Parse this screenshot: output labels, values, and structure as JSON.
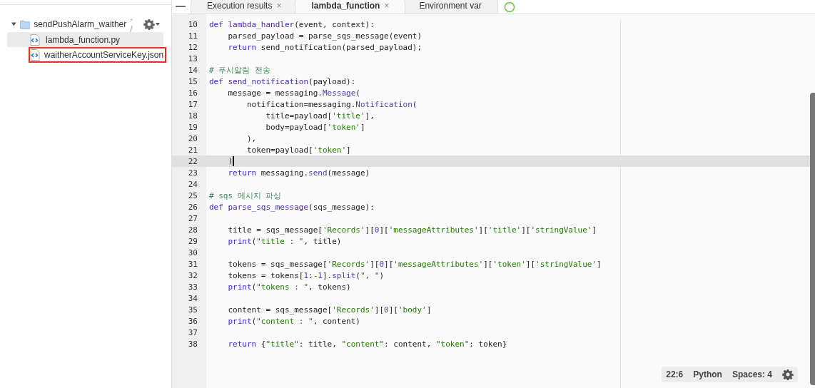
{
  "tabs": [
    {
      "label": "Execution results",
      "close": "×",
      "selected": false
    },
    {
      "label": "lambda_function",
      "close": "×",
      "selected": true
    },
    {
      "label": "Environment var",
      "selected": false
    }
  ],
  "file_tree": {
    "folder": {
      "name": "sendPushAlarm_waither",
      "path": " - /",
      "expanded": true,
      "children": [
        {
          "name": "lambda_function.py",
          "selected": true,
          "annotated": false
        },
        {
          "name": "waitherAccountServiceKey.json",
          "selected": false,
          "annotated": true
        }
      ]
    }
  },
  "editor": {
    "lines": [
      {
        "number": "10",
        "current": false,
        "tokens": [
          {
            "kind": "kw",
            "text": "def "
          },
          {
            "kind": "fn",
            "text": "lambda_handler"
          },
          {
            "kind": "plain",
            "text": "(event, context):"
          }
        ]
      },
      {
        "number": "11",
        "current": false,
        "tokens": [
          {
            "kind": "plain",
            "text": "    parsed_payload = parse_sqs_message(event)"
          }
        ]
      },
      {
        "number": "12",
        "current": false,
        "tokens": [
          {
            "kind": "kw",
            "text": "    return"
          },
          {
            "kind": "plain",
            "text": " send_notification(parsed_payload);"
          }
        ]
      },
      {
        "number": "13",
        "current": false
      },
      {
        "number": "14",
        "current": false,
        "tokens": [
          {
            "kind": "comment",
            "text": "# 푸시알림 전송"
          }
        ]
      },
      {
        "number": "15",
        "current": false,
        "tokens": [
          {
            "kind": "kw",
            "text": "def "
          },
          {
            "kind": "fn",
            "text": "send_notification"
          },
          {
            "kind": "plain",
            "text": "(payload):"
          }
        ]
      },
      {
        "number": "16",
        "current": false,
        "tokens": [
          {
            "kind": "plain",
            "text": "    message = messaging."
          },
          {
            "kind": "prop",
            "text": "Message"
          },
          {
            "kind": "plain",
            "text": "("
          }
        ]
      },
      {
        "number": "17",
        "current": false,
        "tokens": [
          {
            "kind": "plain",
            "text": "        notification=messaging."
          },
          {
            "kind": "prop",
            "text": "Notification"
          },
          {
            "kind": "plain",
            "text": "("
          }
        ]
      },
      {
        "number": "18",
        "current": false,
        "tokens": [
          {
            "kind": "plain",
            "text": "            title=payload["
          },
          {
            "kind": "str",
            "text": "'title'"
          },
          {
            "kind": "plain",
            "text": "],"
          }
        ]
      },
      {
        "number": "19",
        "current": false,
        "tokens": [
          {
            "kind": "plain",
            "text": "            body=payload["
          },
          {
            "kind": "str",
            "text": "'token'"
          },
          {
            "kind": "plain",
            "text": "]"
          }
        ]
      },
      {
        "number": "20",
        "current": false,
        "tokens": [
          {
            "kind": "plain",
            "text": "        ),"
          }
        ]
      },
      {
        "number": "21",
        "current": false,
        "tokens": [
          {
            "kind": "plain",
            "text": "        token=payload["
          },
          {
            "kind": "str",
            "text": "'token'"
          },
          {
            "kind": "plain",
            "text": "]"
          }
        ]
      },
      {
        "number": "22",
        "current": true,
        "tokens": [
          {
            "kind": "plain",
            "text": "    )"
          }
        ]
      },
      {
        "number": "23",
        "current": false,
        "tokens": [
          {
            "kind": "kw",
            "text": "    return"
          },
          {
            "kind": "plain",
            "text": " messaging."
          },
          {
            "kind": "prop",
            "text": "send"
          },
          {
            "kind": "plain",
            "text": "(message)"
          }
        ]
      },
      {
        "number": "24",
        "current": false
      },
      {
        "number": "25",
        "current": false,
        "tokens": [
          {
            "kind": "comment",
            "text": "# sqs 메시지 파싱"
          }
        ]
      },
      {
        "number": "26",
        "current": false,
        "tokens": [
          {
            "kind": "kw",
            "text": "def "
          },
          {
            "kind": "fn",
            "text": "parse_sqs_message"
          },
          {
            "kind": "plain",
            "text": "(sqs_message):"
          }
        ]
      },
      {
        "number": "27",
        "current": false
      },
      {
        "number": "28",
        "current": false,
        "tokens": [
          {
            "kind": "plain",
            "text": "    title = sqs_message["
          },
          {
            "kind": "str",
            "text": "'Records'"
          },
          {
            "kind": "plain",
            "text": "]["
          },
          {
            "kind": "num",
            "text": "0"
          },
          {
            "kind": "plain",
            "text": "]["
          },
          {
            "kind": "str",
            "text": "'messageAttributes'"
          },
          {
            "kind": "plain",
            "text": "]["
          },
          {
            "kind": "str",
            "text": "'title'"
          },
          {
            "kind": "plain",
            "text": "]["
          },
          {
            "kind": "str",
            "text": "'stringValue'"
          },
          {
            "kind": "plain",
            "text": "]"
          }
        ]
      },
      {
        "number": "29",
        "current": false,
        "tokens": [
          {
            "kind": "kw",
            "text": "    print"
          },
          {
            "kind": "plain",
            "text": "("
          },
          {
            "kind": "str",
            "text": "\"title : \""
          },
          {
            "kind": "plain",
            "text": ", title)"
          }
        ]
      },
      {
        "number": "30",
        "current": false
      },
      {
        "number": "31",
        "current": false,
        "tokens": [
          {
            "kind": "plain",
            "text": "    tokens = sqs_message["
          },
          {
            "kind": "str",
            "text": "'Records'"
          },
          {
            "kind": "plain",
            "text": "]["
          },
          {
            "kind": "num",
            "text": "0"
          },
          {
            "kind": "plain",
            "text": "]["
          },
          {
            "kind": "str",
            "text": "'messageAttributes'"
          },
          {
            "kind": "plain",
            "text": "]["
          },
          {
            "kind": "str",
            "text": "'token'"
          },
          {
            "kind": "plain",
            "text": "]["
          },
          {
            "kind": "str",
            "text": "'stringValue'"
          },
          {
            "kind": "plain",
            "text": "]"
          }
        ]
      },
      {
        "number": "32",
        "current": false,
        "tokens": [
          {
            "kind": "plain",
            "text": "    tokens = tokens["
          },
          {
            "kind": "num",
            "text": "1"
          },
          {
            "kind": "plain",
            "text": ":"
          },
          {
            "kind": "num",
            "text": "-1"
          },
          {
            "kind": "plain",
            "text": "]."
          },
          {
            "kind": "prop",
            "text": "split"
          },
          {
            "kind": "plain",
            "text": "("
          },
          {
            "kind": "str",
            "text": "\", \""
          },
          {
            "kind": "plain",
            "text": ")"
          }
        ]
      },
      {
        "number": "33",
        "current": false,
        "tokens": [
          {
            "kind": "kw",
            "text": "    print"
          },
          {
            "kind": "plain",
            "text": "("
          },
          {
            "kind": "str",
            "text": "\"tokens : \""
          },
          {
            "kind": "plain",
            "text": ", tokens)"
          }
        ]
      },
      {
        "number": "34",
        "current": false
      },
      {
        "number": "35",
        "current": false,
        "tokens": [
          {
            "kind": "plain",
            "text": "    content = sqs_message["
          },
          {
            "kind": "str",
            "text": "'Records'"
          },
          {
            "kind": "plain",
            "text": "]["
          },
          {
            "kind": "num",
            "text": "0"
          },
          {
            "kind": "plain",
            "text": "]["
          },
          {
            "kind": "str",
            "text": "'body'"
          },
          {
            "kind": "plain",
            "text": "]"
          }
        ]
      },
      {
        "number": "36",
        "current": false,
        "tokens": [
          {
            "kind": "kw",
            "text": "    print"
          },
          {
            "kind": "plain",
            "text": "("
          },
          {
            "kind": "str",
            "text": "\"content : \""
          },
          {
            "kind": "plain",
            "text": ", content)"
          }
        ]
      },
      {
        "number": "37",
        "current": false
      },
      {
        "number": "38",
        "current": false,
        "tokens": [
          {
            "kind": "kw",
            "text": "    return"
          },
          {
            "kind": "plain",
            "text": " {"
          },
          {
            "kind": "str",
            "text": "\"title\""
          },
          {
            "kind": "plain",
            "text": ": title, "
          },
          {
            "kind": "str",
            "text": "\"content\""
          },
          {
            "kind": "plain",
            "text": ": content, "
          },
          {
            "kind": "str",
            "text": "\"token\""
          },
          {
            "kind": "plain",
            "text": ": token}"
          }
        ]
      }
    ]
  },
  "status_bar": {
    "position": "22:6",
    "language": "Python",
    "indent": "Spaces: 4"
  }
}
